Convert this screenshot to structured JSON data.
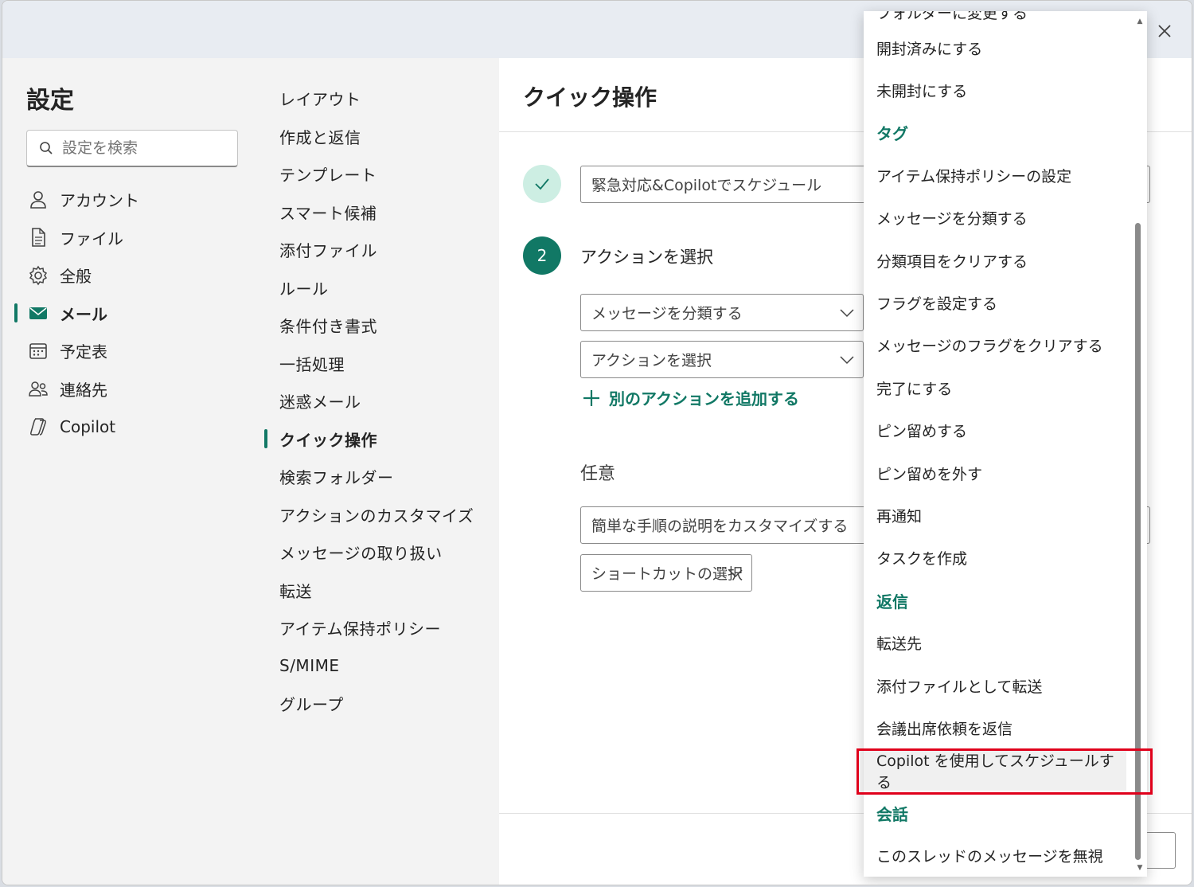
{
  "settings": {
    "title": "設定",
    "search_placeholder": "設定を検索",
    "nav": [
      {
        "label": "アカウント",
        "icon": "person-icon"
      },
      {
        "label": "ファイル",
        "icon": "file-icon"
      },
      {
        "label": "全般",
        "icon": "gear-icon"
      },
      {
        "label": "メール",
        "icon": "mail-icon",
        "active": true
      },
      {
        "label": "予定表",
        "icon": "calendar-icon"
      },
      {
        "label": "連絡先",
        "icon": "people-icon"
      },
      {
        "label": "Copilot",
        "icon": "copilot-icon"
      }
    ]
  },
  "mail_nav": {
    "items": [
      "レイアウト",
      "作成と返信",
      "テンプレート",
      "スマート候補",
      "添付ファイル",
      "ルール",
      "条件付き書式",
      "一括処理",
      "迷惑メール",
      "クイック操作",
      "検索フォルダー",
      "アクションのカスタマイズ",
      "メッセージの取り扱い",
      "転送",
      "アイテム保持ポリシー",
      "S/MIME",
      "グループ"
    ],
    "active_index": 9
  },
  "content": {
    "title": "クイック操作",
    "step1_name": "緊急対応&Copilotでスケジュール",
    "step2_number": "2",
    "step2_label": "アクションを選択",
    "action1": "メッセージを分類する",
    "action2": "アクションを選択",
    "add_action": "別のアクションを追加する",
    "optional_label": "任意",
    "description_placeholder": "簡単な手順の説明をカスタマイズする",
    "shortcut": "ショートカットの選択"
  },
  "dropdown": {
    "partial_top": "フォルダーに変更する",
    "items": [
      {
        "label": "開封済みにする"
      },
      {
        "label": "未開封にする"
      },
      {
        "label": "タグ",
        "header": true
      },
      {
        "label": "アイテム保持ポリシーの設定"
      },
      {
        "label": "メッセージを分類する"
      },
      {
        "label": "分類項目をクリアする"
      },
      {
        "label": "フラグを設定する"
      },
      {
        "label": "メッセージのフラグをクリアする"
      },
      {
        "label": "完了にする"
      },
      {
        "label": "ピン留めする"
      },
      {
        "label": "ピン留めを外す"
      },
      {
        "label": "再通知"
      },
      {
        "label": "タスクを作成"
      },
      {
        "label": "返信",
        "header": true
      },
      {
        "label": "転送先"
      },
      {
        "label": "添付ファイルとして転送"
      },
      {
        "label": "会議出席依頼を返信"
      },
      {
        "label": "Copilot を使用してスケジュールする",
        "highlighted": true
      },
      {
        "label": "会話",
        "header": true
      },
      {
        "label": "このスレッドのメッセージを無視"
      }
    ]
  },
  "colors": {
    "accent": "#117865",
    "highlight_box": "#e0001b"
  }
}
